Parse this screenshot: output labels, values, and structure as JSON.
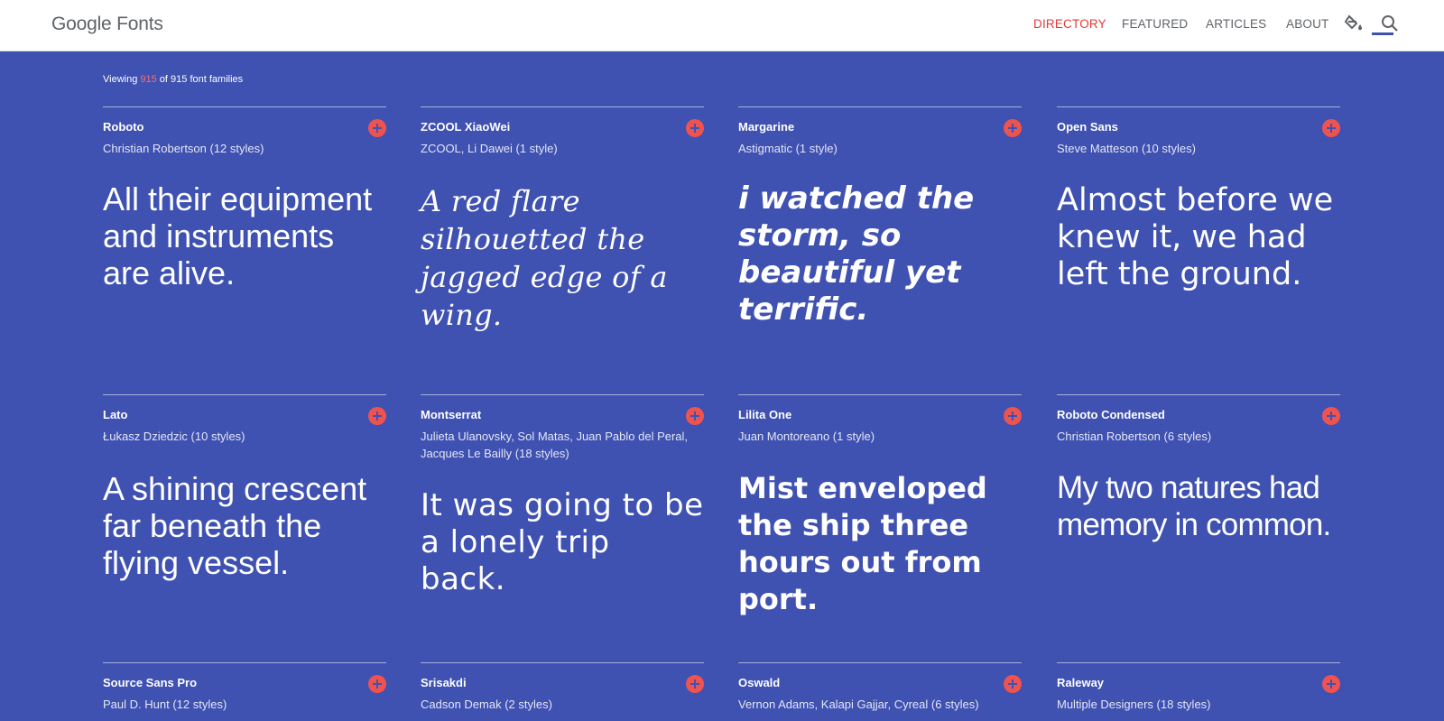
{
  "header": {
    "logo": "Google Fonts",
    "nav": [
      "DIRECTORY",
      "FEATURED",
      "ARTICLES",
      "ABOUT"
    ],
    "icons": [
      "paint-bucket-icon",
      "search-icon"
    ],
    "accent": "#e53935"
  },
  "summary": {
    "prefix": "Viewing",
    "shown": "915",
    "suffix": "of 915 font families"
  },
  "colors": {
    "background": "#3f51b1",
    "add_button": "#ef5350"
  },
  "fonts": [
    {
      "name": "Roboto",
      "designer": "Christian Robertson (12 styles)",
      "sample": "All their equipment and instruments are alive."
    },
    {
      "name": "ZCOOL XiaoWei",
      "designer": "ZCOOL, Li Dawei (1 style)",
      "sample": "A red flare silhouetted the jagged edge of a wing."
    },
    {
      "name": "Margarine",
      "designer": "Astigmatic (1 style)",
      "sample": "i watched the storm, so beautiful yet terrific."
    },
    {
      "name": "Open Sans",
      "designer": "Steve Matteson (10 styles)",
      "sample": "Almost before we knew it, we had left the ground."
    },
    {
      "name": "Lato",
      "designer": "Łukasz Dziedzic (10 styles)",
      "sample": "A shining crescent far beneath the flying vessel."
    },
    {
      "name": "Montserrat",
      "designer": "Julieta Ulanovsky, Sol Matas, Juan Pablo del Peral, Jacques Le Bailly (18 styles)",
      "sample": "It was going to be a lonely trip back."
    },
    {
      "name": "Lilita One",
      "designer": "Juan Montoreano (1 style)",
      "sample": "Mist enveloped the ship three hours out from port."
    },
    {
      "name": "Roboto Condensed",
      "designer": "Christian Robertson (6 styles)",
      "sample": "My two natures had memory in common."
    },
    {
      "name": "Source Sans Pro",
      "designer": "Paul D. Hunt (12 styles)",
      "sample": ""
    },
    {
      "name": "Srisakdi",
      "designer": "Cadson Demak (2 styles)",
      "sample": ""
    },
    {
      "name": "Oswald",
      "designer": "Vernon Adams, Kalapi Gajjar, Cyreal (6 styles)",
      "sample": ""
    },
    {
      "name": "Raleway",
      "designer": "Multiple Designers (18 styles)",
      "sample": ""
    }
  ]
}
